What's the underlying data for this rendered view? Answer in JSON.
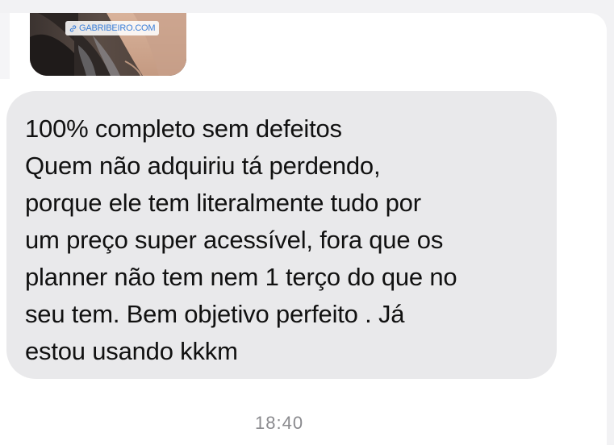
{
  "thread": {
    "shared_image": {
      "watermark": "GABRIBEIRO.COM",
      "link_icon": "link-icon"
    },
    "message": {
      "lines": [
        "100% completo sem defeitos",
        "Quem não adquiriu tá perdendo,",
        "porque ele tem literalmente tudo por",
        "um preço super acessível, fora que os",
        "planner não tem nem 1 terço do que no",
        "seu tem. Bem objetivo perfeito . Já",
        "estou usando kkkm"
      ]
    },
    "timestamp": "18:40"
  },
  "colors": {
    "background": "#f2f2f4",
    "bubble": "#e9e9eb",
    "text": "#111111",
    "watermark_text": "#3a7ed8",
    "timestamp": "#8a8a8e"
  }
}
